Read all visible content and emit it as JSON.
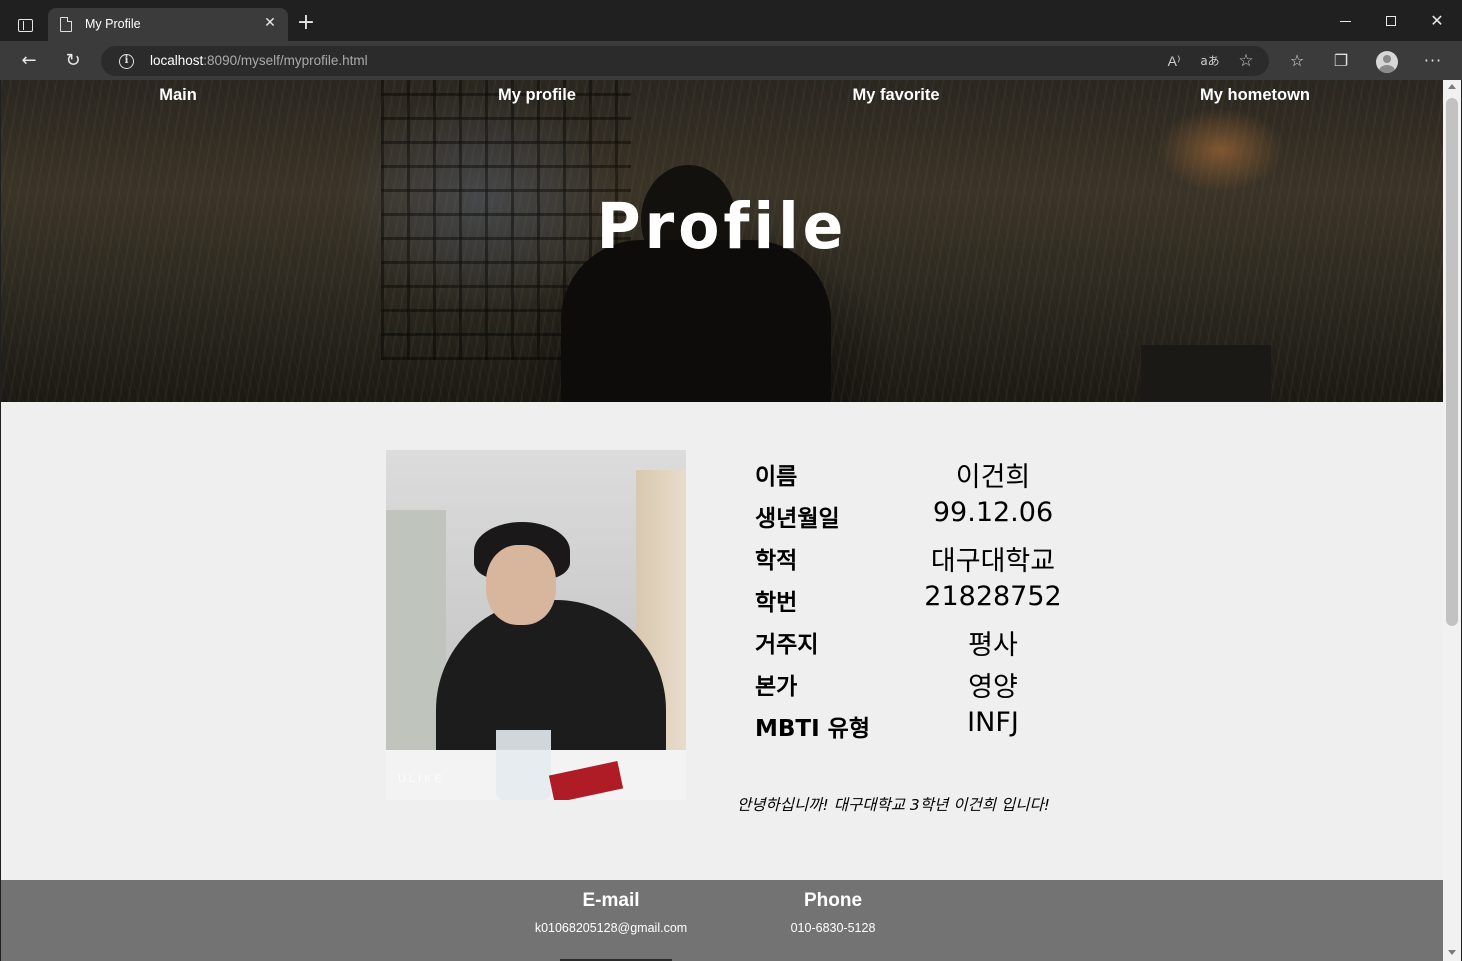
{
  "browser": {
    "tab_title": "My Profile",
    "tab_close": "✕",
    "new_tab": "+",
    "url_host": "localhost",
    "url_rest": ":8090/myself/myprofile.html",
    "read_aloud": "A⁾",
    "translate": "aあ",
    "more": "···"
  },
  "nav": {
    "items": [
      "Main",
      "My profile",
      "My favorite",
      "My hometown"
    ]
  },
  "hero": {
    "title": "Profile"
  },
  "profile": {
    "photo_watermark": "ULIKE",
    "rows": [
      {
        "label": "이름",
        "value": "이건희"
      },
      {
        "label": "생년월일",
        "value": "99.12.06"
      },
      {
        "label": "학적",
        "value": "대구대학교"
      },
      {
        "label": "학번",
        "value": "21828752"
      },
      {
        "label": "거주지",
        "value": "평사"
      },
      {
        "label": "본가",
        "value": "영양"
      },
      {
        "label": "MBTI 유형",
        "value": "INFJ"
      }
    ],
    "greeting": "안녕하십니까! 대구대학교 3학년 이건희 입니다!"
  },
  "footer": {
    "email_heading": "E-mail",
    "email_value": "k01068205128@gmail.com",
    "phone_heading": "Phone",
    "phone_value": "010-6830-5128"
  }
}
